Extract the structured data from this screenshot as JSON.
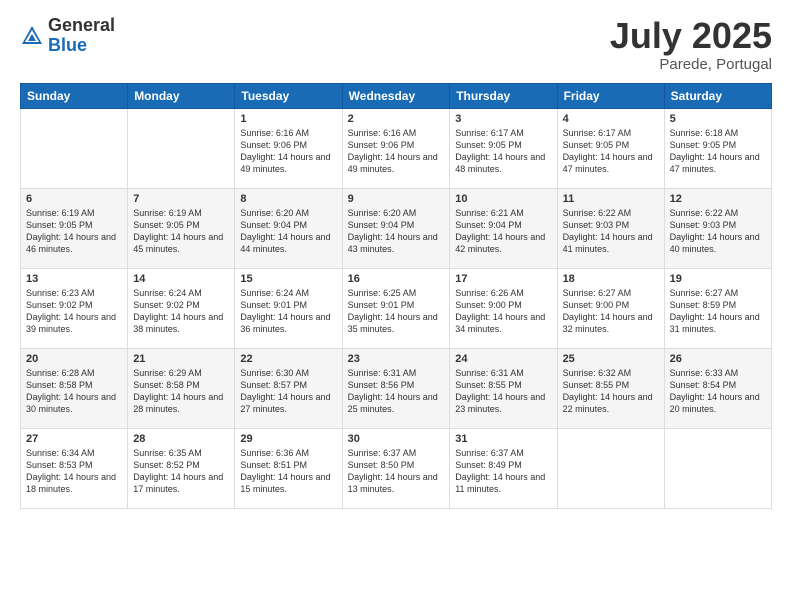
{
  "logo": {
    "general": "General",
    "blue": "Blue"
  },
  "title": "July 2025",
  "location": "Parede, Portugal",
  "days_header": [
    "Sunday",
    "Monday",
    "Tuesday",
    "Wednesday",
    "Thursday",
    "Friday",
    "Saturday"
  ],
  "weeks": [
    [
      {
        "day": "",
        "sunrise": "",
        "sunset": "",
        "daylight": ""
      },
      {
        "day": "",
        "sunrise": "",
        "sunset": "",
        "daylight": ""
      },
      {
        "day": "1",
        "sunrise": "Sunrise: 6:16 AM",
        "sunset": "Sunset: 9:06 PM",
        "daylight": "Daylight: 14 hours and 49 minutes."
      },
      {
        "day": "2",
        "sunrise": "Sunrise: 6:16 AM",
        "sunset": "Sunset: 9:06 PM",
        "daylight": "Daylight: 14 hours and 49 minutes."
      },
      {
        "day": "3",
        "sunrise": "Sunrise: 6:17 AM",
        "sunset": "Sunset: 9:05 PM",
        "daylight": "Daylight: 14 hours and 48 minutes."
      },
      {
        "day": "4",
        "sunrise": "Sunrise: 6:17 AM",
        "sunset": "Sunset: 9:05 PM",
        "daylight": "Daylight: 14 hours and 47 minutes."
      },
      {
        "day": "5",
        "sunrise": "Sunrise: 6:18 AM",
        "sunset": "Sunset: 9:05 PM",
        "daylight": "Daylight: 14 hours and 47 minutes."
      }
    ],
    [
      {
        "day": "6",
        "sunrise": "Sunrise: 6:19 AM",
        "sunset": "Sunset: 9:05 PM",
        "daylight": "Daylight: 14 hours and 46 minutes."
      },
      {
        "day": "7",
        "sunrise": "Sunrise: 6:19 AM",
        "sunset": "Sunset: 9:05 PM",
        "daylight": "Daylight: 14 hours and 45 minutes."
      },
      {
        "day": "8",
        "sunrise": "Sunrise: 6:20 AM",
        "sunset": "Sunset: 9:04 PM",
        "daylight": "Daylight: 14 hours and 44 minutes."
      },
      {
        "day": "9",
        "sunrise": "Sunrise: 6:20 AM",
        "sunset": "Sunset: 9:04 PM",
        "daylight": "Daylight: 14 hours and 43 minutes."
      },
      {
        "day": "10",
        "sunrise": "Sunrise: 6:21 AM",
        "sunset": "Sunset: 9:04 PM",
        "daylight": "Daylight: 14 hours and 42 minutes."
      },
      {
        "day": "11",
        "sunrise": "Sunrise: 6:22 AM",
        "sunset": "Sunset: 9:03 PM",
        "daylight": "Daylight: 14 hours and 41 minutes."
      },
      {
        "day": "12",
        "sunrise": "Sunrise: 6:22 AM",
        "sunset": "Sunset: 9:03 PM",
        "daylight": "Daylight: 14 hours and 40 minutes."
      }
    ],
    [
      {
        "day": "13",
        "sunrise": "Sunrise: 6:23 AM",
        "sunset": "Sunset: 9:02 PM",
        "daylight": "Daylight: 14 hours and 39 minutes."
      },
      {
        "day": "14",
        "sunrise": "Sunrise: 6:24 AM",
        "sunset": "Sunset: 9:02 PM",
        "daylight": "Daylight: 14 hours and 38 minutes."
      },
      {
        "day": "15",
        "sunrise": "Sunrise: 6:24 AM",
        "sunset": "Sunset: 9:01 PM",
        "daylight": "Daylight: 14 hours and 36 minutes."
      },
      {
        "day": "16",
        "sunrise": "Sunrise: 6:25 AM",
        "sunset": "Sunset: 9:01 PM",
        "daylight": "Daylight: 14 hours and 35 minutes."
      },
      {
        "day": "17",
        "sunrise": "Sunrise: 6:26 AM",
        "sunset": "Sunset: 9:00 PM",
        "daylight": "Daylight: 14 hours and 34 minutes."
      },
      {
        "day": "18",
        "sunrise": "Sunrise: 6:27 AM",
        "sunset": "Sunset: 9:00 PM",
        "daylight": "Daylight: 14 hours and 32 minutes."
      },
      {
        "day": "19",
        "sunrise": "Sunrise: 6:27 AM",
        "sunset": "Sunset: 8:59 PM",
        "daylight": "Daylight: 14 hours and 31 minutes."
      }
    ],
    [
      {
        "day": "20",
        "sunrise": "Sunrise: 6:28 AM",
        "sunset": "Sunset: 8:58 PM",
        "daylight": "Daylight: 14 hours and 30 minutes."
      },
      {
        "day": "21",
        "sunrise": "Sunrise: 6:29 AM",
        "sunset": "Sunset: 8:58 PM",
        "daylight": "Daylight: 14 hours and 28 minutes."
      },
      {
        "day": "22",
        "sunrise": "Sunrise: 6:30 AM",
        "sunset": "Sunset: 8:57 PM",
        "daylight": "Daylight: 14 hours and 27 minutes."
      },
      {
        "day": "23",
        "sunrise": "Sunrise: 6:31 AM",
        "sunset": "Sunset: 8:56 PM",
        "daylight": "Daylight: 14 hours and 25 minutes."
      },
      {
        "day": "24",
        "sunrise": "Sunrise: 6:31 AM",
        "sunset": "Sunset: 8:55 PM",
        "daylight": "Daylight: 14 hours and 23 minutes."
      },
      {
        "day": "25",
        "sunrise": "Sunrise: 6:32 AM",
        "sunset": "Sunset: 8:55 PM",
        "daylight": "Daylight: 14 hours and 22 minutes."
      },
      {
        "day": "26",
        "sunrise": "Sunrise: 6:33 AM",
        "sunset": "Sunset: 8:54 PM",
        "daylight": "Daylight: 14 hours and 20 minutes."
      }
    ],
    [
      {
        "day": "27",
        "sunrise": "Sunrise: 6:34 AM",
        "sunset": "Sunset: 8:53 PM",
        "daylight": "Daylight: 14 hours and 18 minutes."
      },
      {
        "day": "28",
        "sunrise": "Sunrise: 6:35 AM",
        "sunset": "Sunset: 8:52 PM",
        "daylight": "Daylight: 14 hours and 17 minutes."
      },
      {
        "day": "29",
        "sunrise": "Sunrise: 6:36 AM",
        "sunset": "Sunset: 8:51 PM",
        "daylight": "Daylight: 14 hours and 15 minutes."
      },
      {
        "day": "30",
        "sunrise": "Sunrise: 6:37 AM",
        "sunset": "Sunset: 8:50 PM",
        "daylight": "Daylight: 14 hours and 13 minutes."
      },
      {
        "day": "31",
        "sunrise": "Sunrise: 6:37 AM",
        "sunset": "Sunset: 8:49 PM",
        "daylight": "Daylight: 14 hours and 11 minutes."
      },
      {
        "day": "",
        "sunrise": "",
        "sunset": "",
        "daylight": ""
      },
      {
        "day": "",
        "sunrise": "",
        "sunset": "",
        "daylight": ""
      }
    ]
  ]
}
